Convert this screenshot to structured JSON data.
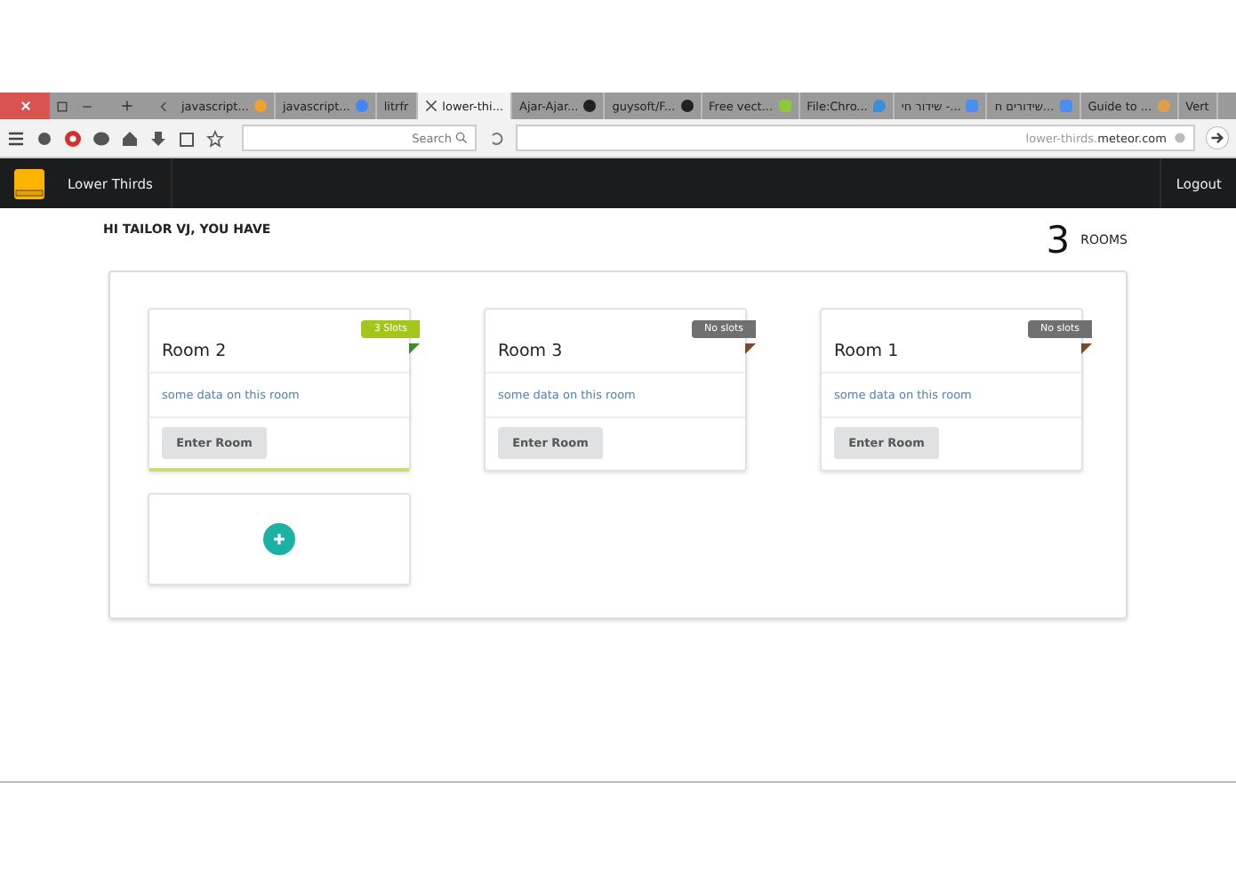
{
  "browser": {
    "tabs": [
      {
        "label": "javascript...",
        "selected": false,
        "kind": "orange"
      },
      {
        "label": "javascript...",
        "selected": false,
        "kind": "google"
      },
      {
        "label": "litrfr",
        "selected": false,
        "kind": "plain"
      },
      {
        "label": "lower-thi...",
        "selected": true,
        "kind": "closable"
      },
      {
        "label": "Ajar-Ajar...",
        "selected": false,
        "kind": "github"
      },
      {
        "label": "guysoft/F...",
        "selected": false,
        "kind": "github"
      },
      {
        "label": "Free vect...",
        "selected": false,
        "kind": "px"
      },
      {
        "label": "File:Chro...",
        "selected": false,
        "kind": "drop"
      },
      {
        "label": "שידור חי -...",
        "selected": false,
        "kind": "doc"
      },
      {
        "label": "שידורים ח...",
        "selected": false,
        "kind": "doc"
      },
      {
        "label": "Guide to ...",
        "selected": false,
        "kind": "face"
      },
      {
        "label": "Vert",
        "selected": false,
        "kind": "plain"
      }
    ],
    "search": {
      "placeholder": "Search"
    },
    "url": {
      "host": "lower-thirds.",
      "domain": "meteor.com"
    }
  },
  "navbar": {
    "brand": "Lower Thirds",
    "logout": "Logout"
  },
  "greeting": "HI TAILOR VJ, YOU HAVE",
  "room_count": {
    "number": "3",
    "label": "ROOMS"
  },
  "rooms": [
    {
      "name": "Room 2",
      "badge": "3 Slots",
      "color": "#a4c61a",
      "has_slots": true,
      "info": "some data on this room",
      "button": "Enter Room"
    },
    {
      "name": "Room 3",
      "badge": "No slots",
      "color": "#707070",
      "has_slots": false,
      "info": "some data on this room",
      "button": "Enter Room"
    },
    {
      "name": "Room 1",
      "badge": "No slots",
      "color": "#707070",
      "has_slots": false,
      "info": "some data on this room",
      "button": "Enter Room"
    }
  ]
}
